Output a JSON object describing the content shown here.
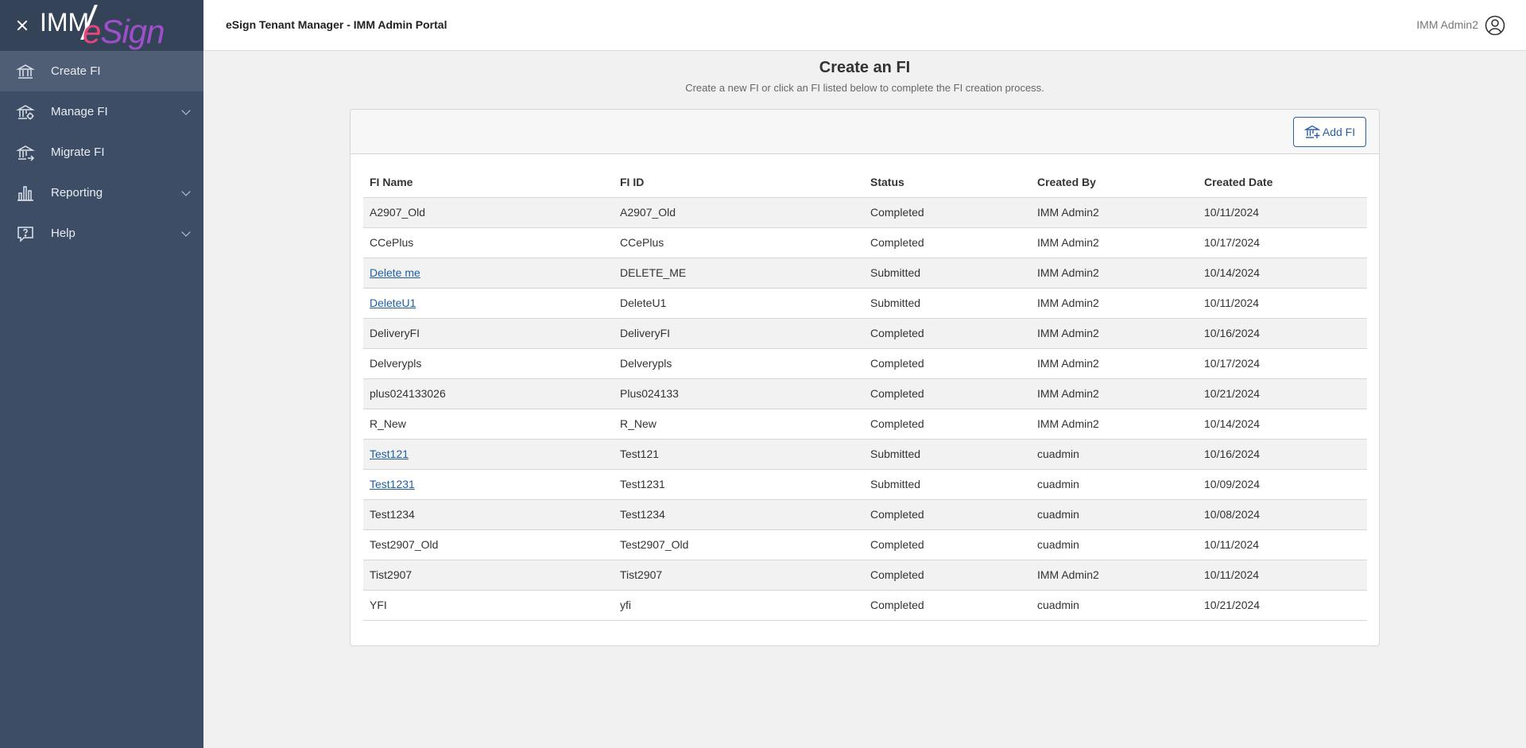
{
  "sidebar": {
    "logo": {
      "part1": "IMM",
      "part2": "e",
      "part3": "Sign"
    },
    "items": [
      {
        "label": "Create FI",
        "icon": "bank-icon",
        "active": true,
        "expandable": false
      },
      {
        "label": "Manage FI",
        "icon": "bank-gear-icon",
        "active": false,
        "expandable": true
      },
      {
        "label": "Migrate FI",
        "icon": "bank-arrow-icon",
        "active": false,
        "expandable": false
      },
      {
        "label": "Reporting",
        "icon": "bar-chart-icon",
        "active": false,
        "expandable": true
      },
      {
        "label": "Help",
        "icon": "help-icon",
        "active": false,
        "expandable": true
      }
    ]
  },
  "header": {
    "title": "eSign Tenant Manager - IMM Admin Portal",
    "user": "IMM Admin2"
  },
  "main": {
    "title": "Create an FI",
    "subtitle": "Create a new FI or click an FI listed below to complete the FI creation process.",
    "add_button": "Add FI",
    "table": {
      "columns": [
        "FI Name",
        "FI ID",
        "Status",
        "Created By",
        "Created Date"
      ],
      "rows": [
        {
          "name": "A2907_Old",
          "id": "A2907_Old",
          "status": "Completed",
          "created_by": "IMM Admin2",
          "date": "10/11/2024",
          "link": false
        },
        {
          "name": "CCePlus",
          "id": "CCePlus",
          "status": "Completed",
          "created_by": "IMM Admin2",
          "date": "10/17/2024",
          "link": false
        },
        {
          "name": "Delete me",
          "id": "DELETE_ME",
          "status": "Submitted",
          "created_by": "IMM Admin2",
          "date": "10/14/2024",
          "link": true
        },
        {
          "name": "DeleteU1",
          "id": "DeleteU1",
          "status": "Submitted",
          "created_by": "IMM Admin2",
          "date": "10/11/2024",
          "link": true
        },
        {
          "name": "DeliveryFI",
          "id": "DeliveryFI",
          "status": "Completed",
          "created_by": "IMM Admin2",
          "date": "10/16/2024",
          "link": false
        },
        {
          "name": "Delverypls",
          "id": "Delverypls",
          "status": "Completed",
          "created_by": "IMM Admin2",
          "date": "10/17/2024",
          "link": false
        },
        {
          "name": "plus024133026",
          "id": "Plus024133",
          "status": "Completed",
          "created_by": "IMM Admin2",
          "date": "10/21/2024",
          "link": false
        },
        {
          "name": "R_New",
          "id": "R_New",
          "status": "Completed",
          "created_by": "IMM Admin2",
          "date": "10/14/2024",
          "link": false
        },
        {
          "name": "Test121",
          "id": "Test121",
          "status": "Submitted",
          "created_by": "cuadmin",
          "date": "10/16/2024",
          "link": true
        },
        {
          "name": "Test1231",
          "id": "Test1231",
          "status": "Submitted",
          "created_by": "cuadmin",
          "date": "10/09/2024",
          "link": true
        },
        {
          "name": "Test1234",
          "id": "Test1234",
          "status": "Completed",
          "created_by": "cuadmin",
          "date": "10/08/2024",
          "link": false
        },
        {
          "name": "Test2907_Old",
          "id": "Test2907_Old",
          "status": "Completed",
          "created_by": "cuadmin",
          "date": "10/11/2024",
          "link": false
        },
        {
          "name": "Tist2907",
          "id": "Tist2907",
          "status": "Completed",
          "created_by": "IMM Admin2",
          "date": "10/11/2024",
          "link": false
        },
        {
          "name": "YFI",
          "id": "yfi",
          "status": "Completed",
          "created_by": "cuadmin",
          "date": "10/21/2024",
          "link": false
        }
      ]
    }
  },
  "colors": {
    "sidebar": "#3d4d66",
    "sidebar_active": "#4f5e75",
    "link": "#1f5fa0",
    "accent_pink": "#e5457a",
    "accent_purple": "#9e4fc9"
  }
}
